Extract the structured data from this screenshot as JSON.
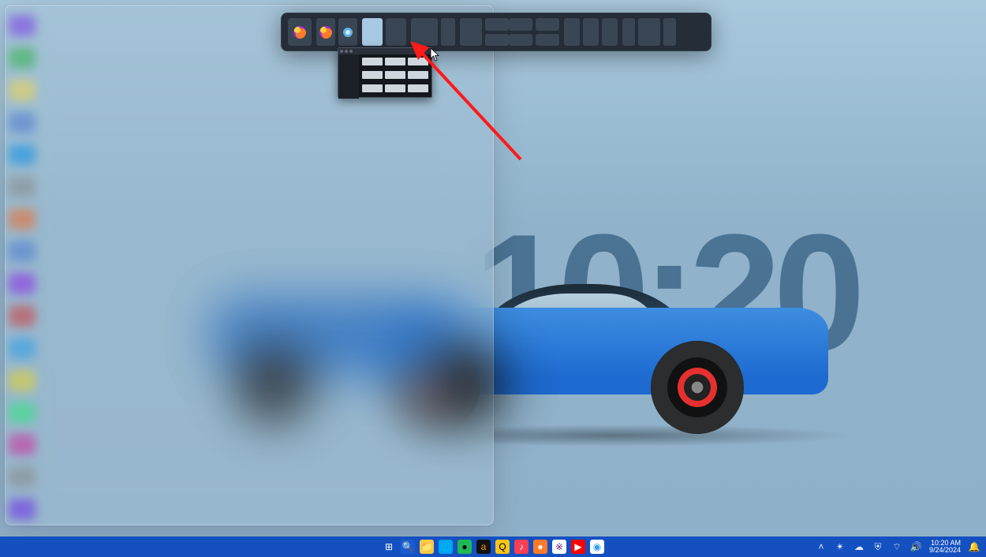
{
  "wallpaper": {
    "clock_text": "10:20"
  },
  "snap_flyout": {
    "active_zone": "split-left",
    "candidate_app": "File Explorer"
  },
  "annotation": {
    "type": "arrow",
    "color": "#ff1a1a"
  },
  "desktop_icon_colors": [
    "#7a3ae6",
    "#33b24b",
    "#f0d44b",
    "#4b7bd0",
    "#0b8ee6",
    "#8a8a8a",
    "#ef6c2a",
    "#4b7bd0",
    "#8a2ae6",
    "#d03b3b",
    "#2a9de6",
    "#e6d32a",
    "#2ae67a",
    "#d02a9d",
    "#8a8a8a",
    "#6a2ae6"
  ],
  "taskbar": {
    "center_icons": [
      {
        "name": "start-icon",
        "glyph": "⊞",
        "bg": "#1450c0",
        "fg": "#fff"
      },
      {
        "name": "search-icon",
        "glyph": "🔍",
        "bg": "#1b5bd1",
        "fg": "#fff"
      },
      {
        "name": "file-explorer-icon",
        "glyph": "📁",
        "bg": "#f7c948",
        "fg": "#000"
      },
      {
        "name": "edge-icon",
        "glyph": "🌐",
        "bg": "#00a4ef",
        "fg": "#fff"
      },
      {
        "name": "spotify-icon",
        "glyph": "●",
        "bg": "#1db954",
        "fg": "#000"
      },
      {
        "name": "amazon-icon",
        "glyph": "a",
        "bg": "#111",
        "fg": "#ff9900"
      },
      {
        "name": "app-q-icon",
        "glyph": "Q",
        "bg": "#f5c518",
        "fg": "#000"
      },
      {
        "name": "music-icon",
        "glyph": "♪",
        "bg": "#fa3e54",
        "fg": "#fff"
      },
      {
        "name": "firefox-icon",
        "glyph": "●",
        "bg": "#ff7b2c",
        "fg": "#fff"
      },
      {
        "name": "slack-icon",
        "glyph": "※",
        "bg": "#fff",
        "fg": "#611f69"
      },
      {
        "name": "youtube-icon",
        "glyph": "▶",
        "bg": "#ff0000",
        "fg": "#fff"
      },
      {
        "name": "chrome-icon",
        "glyph": "◉",
        "bg": "#fff",
        "fg": "#2a9de6"
      }
    ],
    "tray_icons": [
      {
        "name": "overflow-icon",
        "glyph": "˄"
      },
      {
        "name": "copilot-icon",
        "glyph": "✴"
      },
      {
        "name": "onedrive-icon",
        "glyph": "☁"
      },
      {
        "name": "security-icon",
        "glyph": "⛨"
      },
      {
        "name": "wifi-icon",
        "glyph": "⌔"
      },
      {
        "name": "volume-icon",
        "glyph": "🔊"
      }
    ],
    "clock": {
      "time": "10:20 AM",
      "date": "9/24/2024"
    },
    "notifications_glyph": "🔔"
  }
}
